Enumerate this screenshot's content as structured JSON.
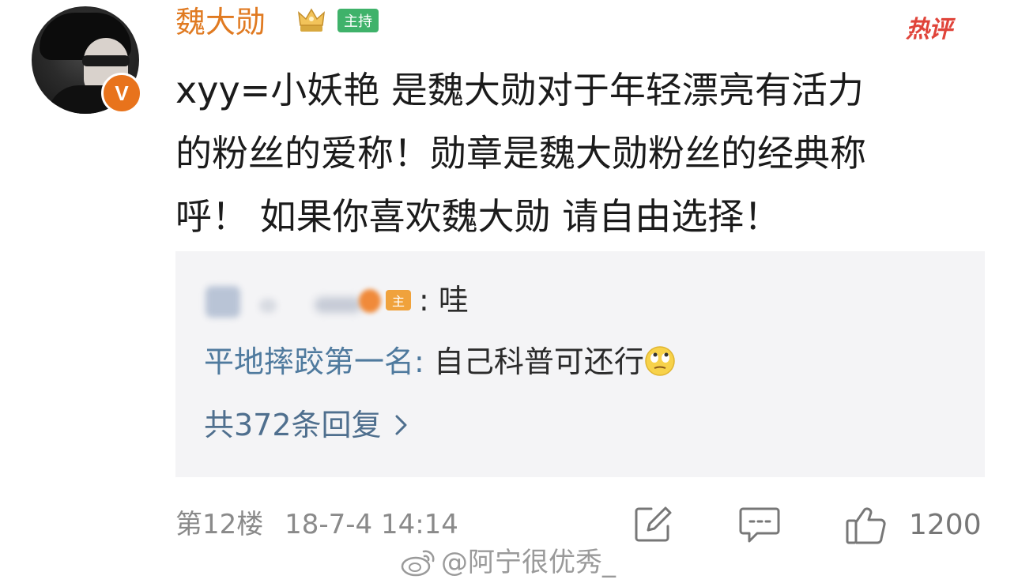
{
  "comment": {
    "username": "魏大勋",
    "host_tag": "主持",
    "hot_badge": "热评",
    "verified_badge": "V",
    "text": "xyy=小妖艳 是魏大勋对于年轻漂亮有活力的粉丝的爱称！勋章是魏大勋粉丝的经典称呼！ 如果你喜欢魏大勋 请自由选择！",
    "text_lines": [
      "xyy=小妖艳 是魏大勋对于年轻漂亮有活力",
      "的粉丝的爱称！勋章是魏大勋粉丝的经典称",
      "呼！ 如果你喜欢魏大勋 请自由选择！"
    ],
    "floor": "第12楼",
    "timestamp": "18-7-4 14:14",
    "like_count": "1200"
  },
  "replies": {
    "items": [
      {
        "name": "",
        "tag": "主",
        "separator": ": ",
        "text": "哇"
      },
      {
        "name": "平地摔跤第一名",
        "separator": ": ",
        "text": "自己科普可还行"
      }
    ],
    "more_label": "共372条回复"
  },
  "icons": {
    "crown": "crown-icon",
    "edit": "edit-share-icon",
    "comment": "comment-icon",
    "like": "thumbs-up-icon",
    "emoji": "eye-roll-emoji-icon",
    "weibo_logo": "weibo-logo-icon"
  },
  "watermark": "@阿宁很优秀_",
  "colors": {
    "username": "#e07a21",
    "host_tag": "#3fb26a",
    "hot_badge": "#e0443a",
    "reply_name": "#4f7a9e",
    "reply_box_bg": "#f4f4f6",
    "verified_badge": "#e8731c"
  }
}
